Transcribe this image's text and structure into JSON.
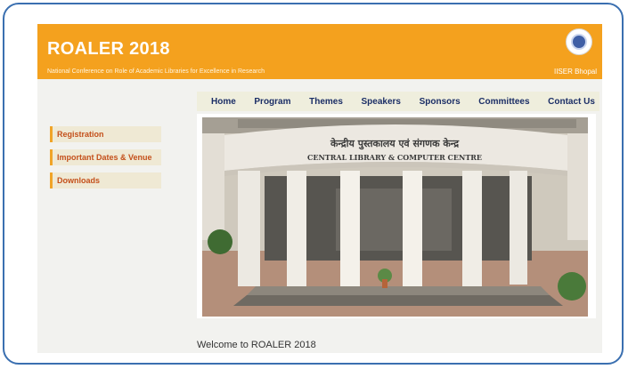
{
  "header": {
    "title": "ROALER 2018",
    "subtitle": "National Conference on Role of Academic Libraries for Excellence in Research",
    "logo_text": "IISER Bhopal",
    "logo_icon": "iiser-seal-logo"
  },
  "nav": {
    "items": [
      "Home",
      "Program",
      "Themes",
      "Speakers",
      "Sponsors",
      "Committees",
      "Contact Us"
    ]
  },
  "sidebar": {
    "items": [
      "Registration",
      "Important Dates & Venue",
      "Downloads"
    ]
  },
  "photo": {
    "sign_hindi": "केन्द्रीय पुस्तकालय एवं संगणक केन्द्र",
    "sign_english": "CENTRAL LIBRARY & COMPUTER CENTRE"
  },
  "welcome": "Welcome to ROALER 2018",
  "colors": {
    "header": "#f4a11e",
    "nav_text": "#1b2e66",
    "sidebar_text": "#c4501b",
    "frame_border": "#3a6fb0"
  }
}
